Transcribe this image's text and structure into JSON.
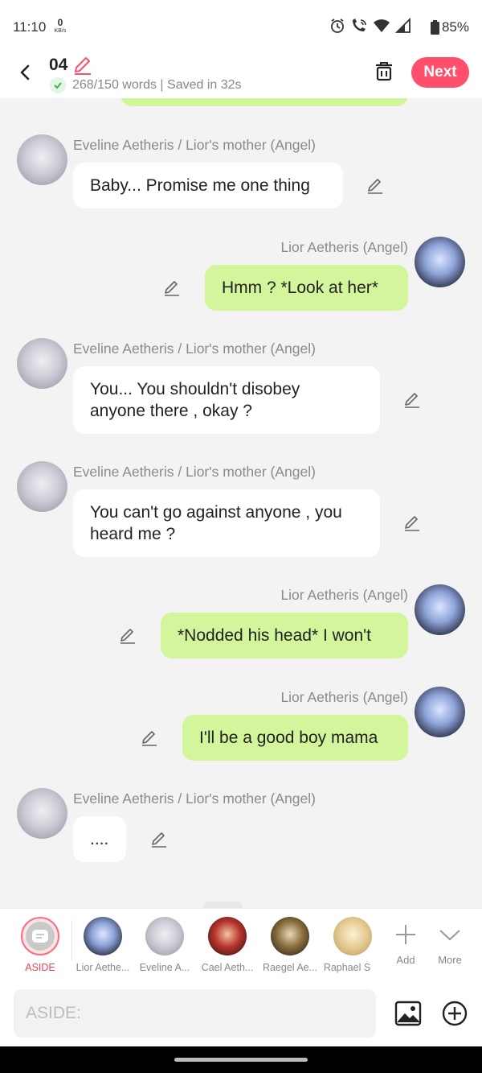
{
  "status_bar": {
    "time": "11:10",
    "net_speed": "0",
    "net_unit": "KB/s",
    "battery": "85%"
  },
  "header": {
    "title": "04",
    "word_count": "268/150 words",
    "saved": "Saved in 32s",
    "next_label": "Next"
  },
  "colors": {
    "accent": "#ff4f6b",
    "user_bubble": "#d3f59b",
    "other_bubble": "#ffffff"
  },
  "messages": [
    {
      "speaker": "Eveline Aetheris / Lior's mother (Angel)",
      "text": "Baby... Promise me one thing",
      "side": "left"
    },
    {
      "speaker": "Lior Aetheris (Angel)",
      "text": "Hmm ?  *Look at her*",
      "side": "right"
    },
    {
      "speaker": "Eveline Aetheris / Lior's mother (Angel)",
      "text_lines": [
        "You... You shouldn't disobey",
        "anyone there , okay ?"
      ],
      "side": "left"
    },
    {
      "speaker": "Eveline Aetheris / Lior's mother (Angel)",
      "text_lines": [
        "You can't go against anyone , you",
        "heard me ?"
      ],
      "side": "left"
    },
    {
      "speaker": "Lior Aetheris (Angel)",
      "text": "*Nodded his head*  I won't",
      "side": "right"
    },
    {
      "speaker": "Lior Aetheris (Angel)",
      "text": "I'll be a good boy mama",
      "side": "right"
    },
    {
      "speaker": "Eveline Aetheris / Lior's mother (Angel)",
      "text": "....",
      "side": "left"
    }
  ],
  "characters": [
    {
      "label": "ASIDE",
      "icon": "aside-icon"
    },
    {
      "label": "Lior Aethe..."
    },
    {
      "label": "Eveline A..."
    },
    {
      "label": "Cael Aeth..."
    },
    {
      "label": "Raegel Ae..."
    },
    {
      "label": "Raphael S"
    }
  ],
  "tools": {
    "add_label": "Add",
    "more_label": "More"
  },
  "input": {
    "placeholder": "ASIDE:"
  }
}
